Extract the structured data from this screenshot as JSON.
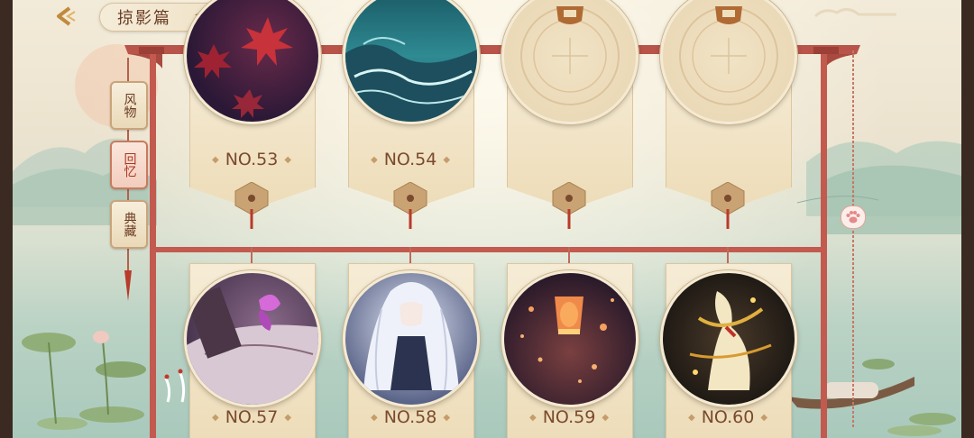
{
  "header": {
    "title": "掠影篇",
    "back_icon": "back-arrow-icon",
    "home_icon": "house-icon"
  },
  "side_tabs": [
    {
      "id": "fengwu",
      "label": "风物",
      "active": false
    },
    {
      "id": "huiyi",
      "label": "回忆",
      "active": true
    },
    {
      "id": "diancang",
      "label": "典藏",
      "active": false
    }
  ],
  "cards_row1": [
    {
      "no": "NO.53",
      "image": "red-maple-leaves",
      "locked": false
    },
    {
      "no": "NO.54",
      "image": "teal-ocean-waves",
      "locked": false
    },
    {
      "no": "",
      "image": "locked-seal",
      "locked": true
    },
    {
      "no": "",
      "image": "locked-seal",
      "locked": true
    }
  ],
  "cards_row2": [
    {
      "no": "NO.57",
      "image": "purple-butterfly-scroll",
      "locked": false
    },
    {
      "no": "NO.58",
      "image": "silver-haired-character",
      "locked": false
    },
    {
      "no": "NO.59",
      "image": "sky-lanterns",
      "locked": false
    },
    {
      "no": "NO.60",
      "image": "golden-dancer",
      "locked": false
    }
  ],
  "scroll_handle_icon": "paw-icon",
  "colors": {
    "frame": "#c0524a",
    "banner": "#f2e4c6",
    "text": "#7a4a2e",
    "active_tab": "#a8361f"
  }
}
